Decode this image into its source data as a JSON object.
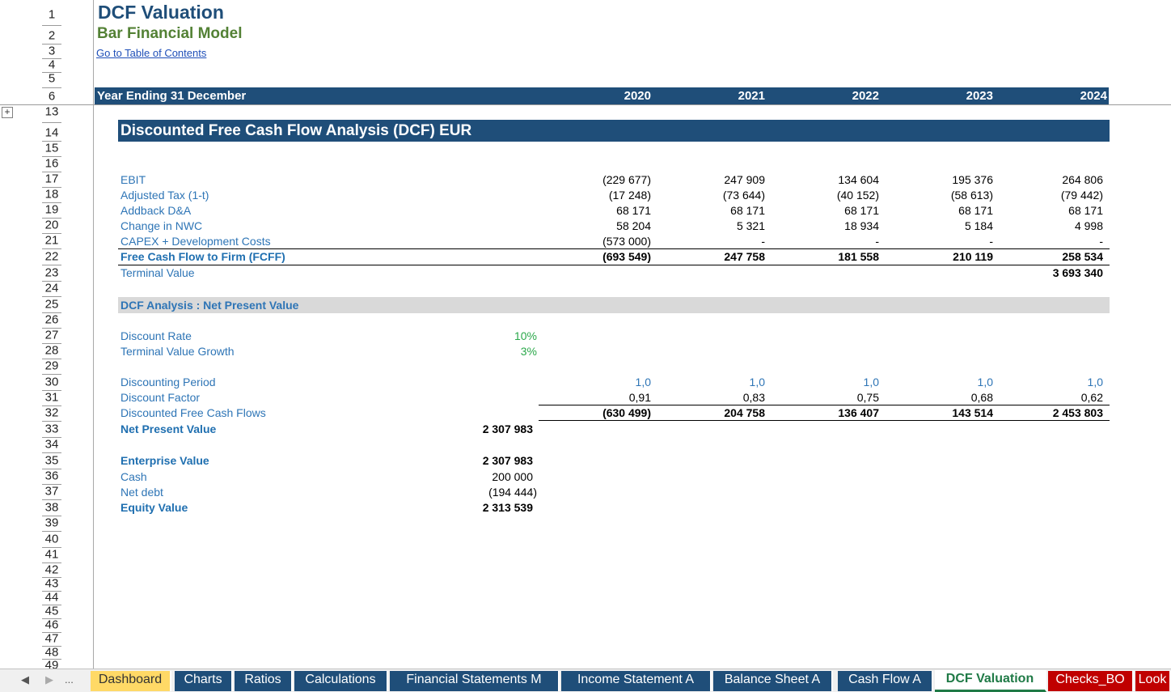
{
  "sheet": {
    "title": "DCF Valuation",
    "subtitle": "Bar  Financial Model",
    "toc_link": "Go to Table of Contents",
    "year_header": {
      "label": "Year Ending 31 December",
      "years": [
        "2020",
        "2021",
        "2022",
        "2023",
        "2024"
      ]
    },
    "section_title": "Discounted Free Cash Flow Analysis (DCF) EUR",
    "cash_flow_rows": [
      {
        "label": "EBIT",
        "values": [
          "(229 677)",
          "247 909",
          "134 604",
          "195 376",
          "264 806"
        ]
      },
      {
        "label": "Adjusted Tax (1-t)",
        "values": [
          "(17 248)",
          "(73 644)",
          "(40 152)",
          "(58 613)",
          "(79 442)"
        ]
      },
      {
        "label": "Addback D&A",
        "values": [
          "68 171",
          "68 171",
          "68 171",
          "68 171",
          "68 171"
        ]
      },
      {
        "label": "Change in NWC",
        "values": [
          "58 204",
          "5 321",
          "18 934",
          "5 184",
          "4 998"
        ]
      },
      {
        "label": "CAPEX + Development Costs",
        "values": [
          "(573 000)",
          "-",
          "-",
          "-",
          "-"
        ]
      }
    ],
    "fcff": {
      "label": "Free Cash Flow to Firm (FCFF)",
      "values": [
        "(693 549)",
        "247 758",
        "181 558",
        "210 119",
        "258 534"
      ]
    },
    "terminal_value": {
      "label": "Terminal Value",
      "value": "3 693 340"
    },
    "npv_section_title": "DCF Analysis : Net Present Value",
    "discount_rate": {
      "label": "Discount Rate",
      "value": "10%"
    },
    "terminal_growth": {
      "label": "Terminal Value Growth",
      "value": "3%"
    },
    "discounting_period": {
      "label": "Discounting Period",
      "values": [
        "1,0",
        "1,0",
        "1,0",
        "1,0",
        "1,0"
      ]
    },
    "discount_factor": {
      "label": "Discount Factor",
      "values": [
        "0,91",
        "0,83",
        "0,75",
        "0,68",
        "0,62"
      ]
    },
    "discounted_fcf": {
      "label": "Discounted Free Cash Flows",
      "values": [
        "(630 499)",
        "204 758",
        "136 407",
        "143 514",
        "2 453 803"
      ]
    },
    "npv": {
      "label": "Net Present Value",
      "value": "2 307 983"
    },
    "enterprise_value": {
      "label": "Enterprise Value",
      "value": "2 307 983"
    },
    "cash": {
      "label": "Cash",
      "value": "200 000"
    },
    "net_debt": {
      "label": "Net debt",
      "value": "(194 444)"
    },
    "equity_value": {
      "label": "Equity Value",
      "value": "2 313 539"
    }
  },
  "row_numbers": [
    "1",
    "2",
    "3",
    "4",
    "5",
    "6",
    "13",
    "14",
    "15",
    "16",
    "17",
    "18",
    "19",
    "20",
    "21",
    "22",
    "23",
    "24",
    "25",
    "26",
    "27",
    "28",
    "29",
    "30",
    "31",
    "32",
    "33",
    "34",
    "35",
    "36",
    "37",
    "38",
    "39",
    "40",
    "41",
    "42",
    "43",
    "44",
    "45",
    "46",
    "47",
    "48",
    "49"
  ],
  "outline_button": "+",
  "tabbar": {
    "nav_prev": "◀",
    "nav_next": "▶",
    "nav_more": "...",
    "tabs": [
      {
        "label": "Dashboard",
        "style": "yellow"
      },
      {
        "label": "Charts",
        "style": "navy"
      },
      {
        "label": "Ratios",
        "style": "navy"
      },
      {
        "label": "Calculations",
        "style": "navy"
      },
      {
        "label": "Financial Statements M",
        "style": "navy"
      },
      {
        "label": "Income Statement A",
        "style": "navy"
      },
      {
        "label": "Balance Sheet A",
        "style": "navy"
      },
      {
        "label": "Cash Flow A",
        "style": "navy"
      },
      {
        "label": "DCF Valuation",
        "style": "active"
      },
      {
        "label": "Checks_BO",
        "style": "red"
      },
      {
        "label": "Look",
        "style": "red"
      }
    ]
  },
  "colors": {
    "header_navy": "#1f4e79",
    "label_blue": "#2e75b6",
    "subtitle_green": "#538135",
    "input_green": "#2aa84a",
    "npv_bar_gray": "#d9d9d9"
  }
}
